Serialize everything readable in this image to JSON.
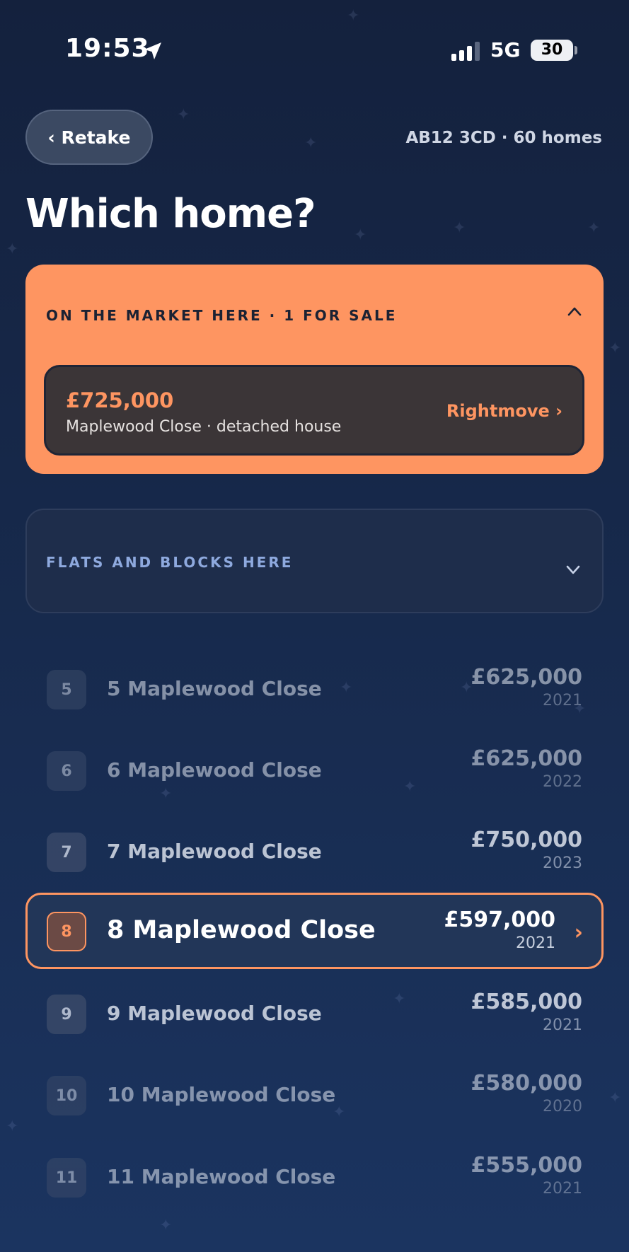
{
  "status_bar": {
    "time": "19:53",
    "network": "5G",
    "battery": "30"
  },
  "header": {
    "back_label": "‹ Retake",
    "postcode_summary": "AB12 3CD · 60 homes",
    "title": "Which home?"
  },
  "market": {
    "title": "ON THE MARKET HERE · 1 FOR SALE",
    "listing": {
      "price": "£725,000",
      "description": "Maplewood Close · detached house",
      "link_label": "Rightmove ›"
    }
  },
  "flats": {
    "title": "FLATS AND BLOCKS HERE"
  },
  "homes": [
    {
      "number": "5",
      "address": "5 Maplewood Close",
      "price": "£625,000",
      "year": "2021"
    },
    {
      "number": "6",
      "address": "6 Maplewood Close",
      "price": "£625,000",
      "year": "2022"
    },
    {
      "number": "7",
      "address": "7 Maplewood Close",
      "price": "£750,000",
      "year": "2023"
    },
    {
      "number": "8",
      "address": "8 Maplewood Close",
      "price": "£597,000",
      "year": "2021",
      "selected": true
    },
    {
      "number": "9",
      "address": "9 Maplewood Close",
      "price": "£585,000",
      "year": "2021"
    },
    {
      "number": "10",
      "address": "10 Maplewood Close",
      "price": "£580,000",
      "year": "2020"
    },
    {
      "number": "11",
      "address": "11 Maplewood Close",
      "price": "£555,000",
      "year": "2021"
    }
  ],
  "colors": {
    "accent": "#fe9561",
    "background": "#172a4d",
    "listing_bg": "#3b3537"
  },
  "icons": [
    "location-arrow-icon",
    "signal-icon",
    "battery-icon",
    "chevron-up-icon",
    "chevron-down-icon",
    "chevron-right-icon"
  ]
}
